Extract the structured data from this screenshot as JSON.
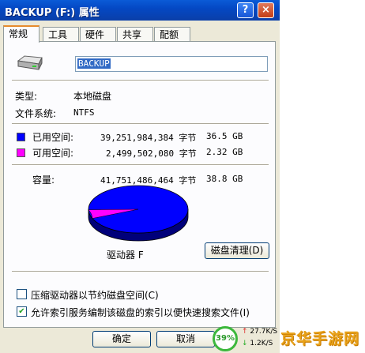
{
  "window": {
    "title": "BACKUP (F:) 属性",
    "help_button": "?",
    "close_button": "×"
  },
  "tabs": [
    {
      "label": "常规",
      "active": true
    },
    {
      "label": "工具",
      "active": false
    },
    {
      "label": "硬件",
      "active": false
    },
    {
      "label": "共享",
      "active": false
    },
    {
      "label": "配额",
      "active": false
    }
  ],
  "general": {
    "drive_icon": "drive-icon",
    "volume_name": "BACKUP",
    "type_label": "类型:",
    "type_value": "本地磁盘",
    "fs_label": "文件系统:",
    "fs_value": "NTFS",
    "used_label": "已用空间:",
    "used_bytes": "39,251,984,384 字节",
    "used_size": "36.5 GB",
    "free_label": "可用空间:",
    "free_bytes": "2,499,502,080 字节",
    "free_size": "2.32 GB",
    "capacity_label": "容量:",
    "capacity_bytes": "41,751,486,464 字节",
    "capacity_size": "38.8 GB",
    "drive_label": "驱动器 F",
    "cleanup_button": "磁盘清理(D)",
    "used_color": "#0000ff",
    "free_color": "#ff00ff",
    "used_fraction": 0.94
  },
  "options": {
    "compress_label": "压缩驱动器以节约磁盘空间(C)",
    "compress_checked": false,
    "index_label": "允许索引服务编制该磁盘的索引以便快速搜索文件(I)",
    "index_checked": true
  },
  "buttons": {
    "ok": "确定",
    "cancel": "取消"
  },
  "speed_widget": {
    "percent": "39%",
    "upload": "27.7K/S",
    "download": "1.2K/S"
  },
  "watermark": "京华手游网"
}
